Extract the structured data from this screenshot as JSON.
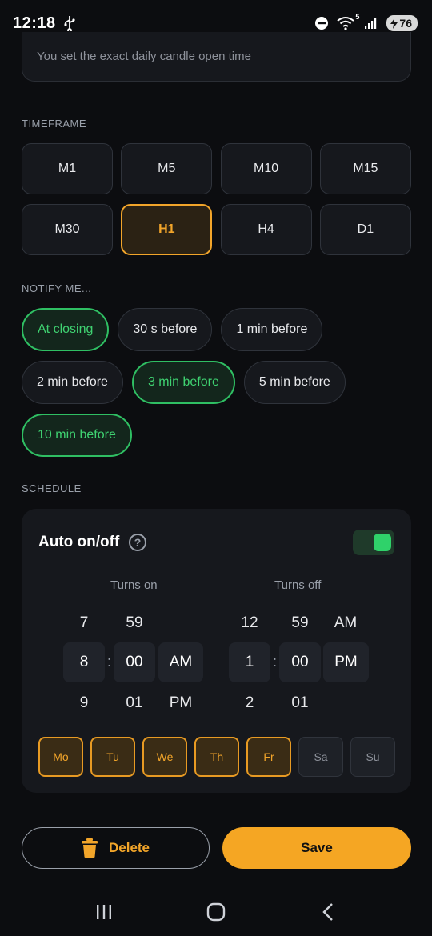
{
  "status": {
    "time": "12:18",
    "battery": "76",
    "wifi_badge": "5"
  },
  "note": "You set the exact daily candle open time",
  "timeframe": {
    "label": "TIMEFRAME",
    "options": [
      "M1",
      "M5",
      "M10",
      "M15",
      "M30",
      "H1",
      "H4",
      "D1"
    ],
    "selected": "H1"
  },
  "notify": {
    "label": "NOTIFY ME...",
    "options": [
      {
        "label": "At closing",
        "active": true
      },
      {
        "label": "30 s before",
        "active": false
      },
      {
        "label": "1 min before",
        "active": false
      },
      {
        "label": "2 min before",
        "active": false
      },
      {
        "label": "3 min before",
        "active": true
      },
      {
        "label": "5 min before",
        "active": false
      },
      {
        "label": "10 min before",
        "active": true
      }
    ]
  },
  "schedule": {
    "label": "SCHEDULE",
    "auto_title": "Auto on/off",
    "help_glyph": "?",
    "toggle_on": true,
    "turns_on": {
      "label": "Turns on",
      "hour_prev": "7",
      "hour": "8",
      "hour_next": "9",
      "min_prev": "59",
      "min": "00",
      "min_next": "01",
      "ampm": "AM",
      "ampm_next": "PM"
    },
    "turns_off": {
      "label": "Turns off",
      "hour_prev": "12",
      "hour": "1",
      "hour_next": "2",
      "min_prev": "59",
      "min": "00",
      "min_next": "01",
      "ampm_prev": "AM",
      "ampm": "PM"
    },
    "separator": ":",
    "days": [
      {
        "label": "Mo",
        "active": true
      },
      {
        "label": "Tu",
        "active": true
      },
      {
        "label": "We",
        "active": true
      },
      {
        "label": "Th",
        "active": true
      },
      {
        "label": "Fr",
        "active": true
      },
      {
        "label": "Sa",
        "active": false
      },
      {
        "label": "Su",
        "active": false
      }
    ]
  },
  "actions": {
    "delete_label": "Delete",
    "save_label": "Save"
  },
  "colors": {
    "accent_orange": "#f5a623",
    "accent_green": "#2fd26a",
    "background": "#0c0d10"
  }
}
